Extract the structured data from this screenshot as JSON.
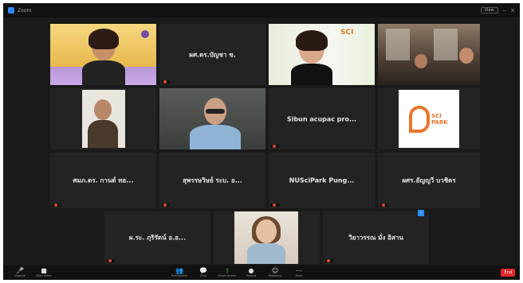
{
  "window": {
    "title": "Zoom"
  },
  "titlebar": {
    "view_label": "View"
  },
  "tiles": [
    {
      "id": "t1",
      "center_name": "",
      "label": ""
    },
    {
      "id": "t2",
      "center_name": "ผศ.ดร.บัญชา ข.",
      "label": ""
    },
    {
      "id": "t3",
      "center_name": "",
      "label": ""
    },
    {
      "id": "t4",
      "center_name": "",
      "label": ""
    },
    {
      "id": "t5",
      "center_name": "",
      "label": ""
    },
    {
      "id": "t6",
      "center_name": "",
      "label": ""
    },
    {
      "id": "t7",
      "center_name": "Sibun acupac pro...",
      "label": ""
    },
    {
      "id": "t8",
      "center_name": "",
      "label": ""
    },
    {
      "id": "t9",
      "center_name": "ศมภ.ดร. กานต์ ทอ...",
      "label": ""
    },
    {
      "id": "t10",
      "center_name": "สุพรรษวิษย์ ระบ. อ...",
      "label": ""
    },
    {
      "id": "t11",
      "center_name": "NUSciPark Pung...",
      "label": ""
    },
    {
      "id": "t12",
      "center_name": "ผศร.อัญญวี บวชิตร",
      "label": ""
    },
    {
      "id": "t13",
      "center_name": "ผ.ระ. ภุริรัตน์ อ.อ...",
      "label": ""
    },
    {
      "id": "t14",
      "center_name": "",
      "label": ""
    },
    {
      "id": "t15",
      "center_name": "วิยาวรรณ มั่ง อิสาน",
      "label": ""
    }
  ],
  "logos": {
    "scipark_text": "SCI PARK",
    "nsp_text": "SCI"
  },
  "toolbar": {
    "items": [
      {
        "icon": "🎤",
        "label": "Unmute"
      },
      {
        "icon": "■",
        "label": "Start Video"
      },
      {
        "icon": "👥",
        "label": "Participants"
      },
      {
        "icon": "💬",
        "label": "Chat"
      },
      {
        "icon": "⇪",
        "label": "Share Screen"
      },
      {
        "icon": "●",
        "label": "Record"
      },
      {
        "icon": "☺",
        "label": "Reactions"
      },
      {
        "icon": "⋯",
        "label": "More"
      }
    ],
    "end_label": "End"
  },
  "colors": {
    "active_speaker": "#9acd32",
    "end_button": "#e02828",
    "zoom_blue": "#2D8CFF"
  }
}
